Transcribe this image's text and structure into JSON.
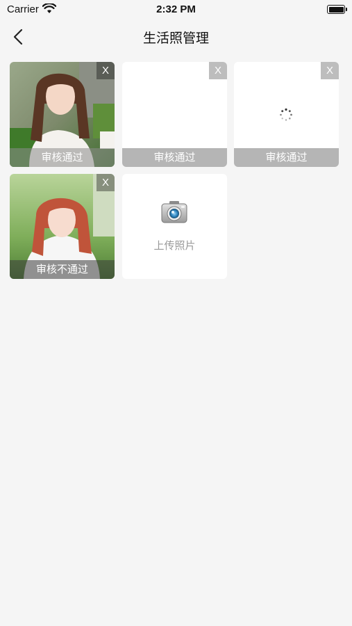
{
  "status_bar": {
    "carrier": "Carrier",
    "time": "2:32 PM"
  },
  "nav": {
    "title": "生活照管理"
  },
  "photos": [
    {
      "status": "审核通过",
      "close": "X"
    },
    {
      "status": "审核通过",
      "close": "X"
    },
    {
      "status": "审核通过",
      "close": "X"
    },
    {
      "status": "审核不通过",
      "close": "X"
    }
  ],
  "upload": {
    "label": "上传照片"
  },
  "icons": [
    "wifi-icon",
    "battery-icon",
    "back-chevron-icon",
    "close-icon",
    "loading-spinner-icon",
    "camera-icon"
  ]
}
